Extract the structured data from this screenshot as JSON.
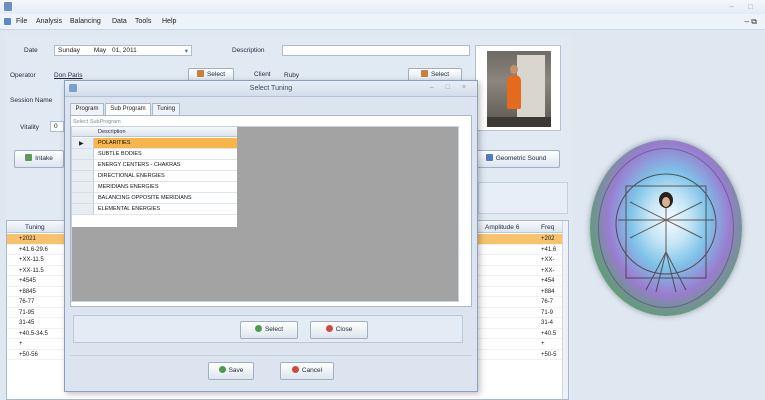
{
  "window": {
    "title": "",
    "menu": [
      "File",
      "Analysis",
      "Balancing",
      "Data",
      "Tools",
      "Help"
    ]
  },
  "session": {
    "date_label": "Date",
    "date_day": "Sunday",
    "date_month": "May",
    "date_rest": "01, 2011",
    "description_label": "Description",
    "operator_label": "Operator",
    "operator_value": "Don Paris",
    "select_label": "Select",
    "client_label": "Client",
    "client_value": "Ruby",
    "client_select_label": "Select",
    "session_name_label": "Session Name",
    "vitality_label": "Vitality",
    "vitality_value": "0",
    "intake_label": "Intake",
    "geometric_sound_label": "Geometric Sound"
  },
  "tuning_grid": {
    "columns": [
      "Tuning",
      "Amplitude 6",
      "Freq"
    ],
    "rows": [
      {
        "tuning": "+2021",
        "freq": "+202"
      },
      {
        "tuning": "+41.6-29.6",
        "freq": "+41.6"
      },
      {
        "tuning": "+XX-11.5",
        "freq": "+XX-"
      },
      {
        "tuning": "+XX-11.5",
        "freq": "+XX-"
      },
      {
        "tuning": "+4545",
        "freq": "+454"
      },
      {
        "tuning": "+8845",
        "freq": "+884"
      },
      {
        "tuning": "76-77",
        "freq": "76-7"
      },
      {
        "tuning": "71-95",
        "freq": "71-9"
      },
      {
        "tuning": "31-45",
        "freq": "31-4"
      },
      {
        "tuning": "+40.5-34.5",
        "freq": "+40.5"
      },
      {
        "tuning": "+",
        "freq": "+"
      },
      {
        "tuning": "+50-56",
        "freq": "+50-5"
      }
    ]
  },
  "modal": {
    "title": "Select Tuning",
    "tabs": [
      "Program",
      "Sub Program",
      "Tuning"
    ],
    "group_label": "Select SubProgram",
    "column_header": "Description",
    "items": [
      "POLARITIES",
      "SUBTLE BODIES",
      "ENERGY CENTERS - CHAKRAS",
      "DIRECTIONAL ENERGIES",
      "MERIDIANS ENERGIES",
      "BALANCING OPPOSITE MERIDIANS",
      "ELEMENTAL ENERGIES"
    ],
    "selected_index": 0,
    "select_button": "Select",
    "close_button": "Close",
    "save_button": "Save",
    "cancel_button": "Cancel"
  },
  "colors": {
    "selected_row": "#f7b54a",
    "accent": "#7d9fcb"
  }
}
